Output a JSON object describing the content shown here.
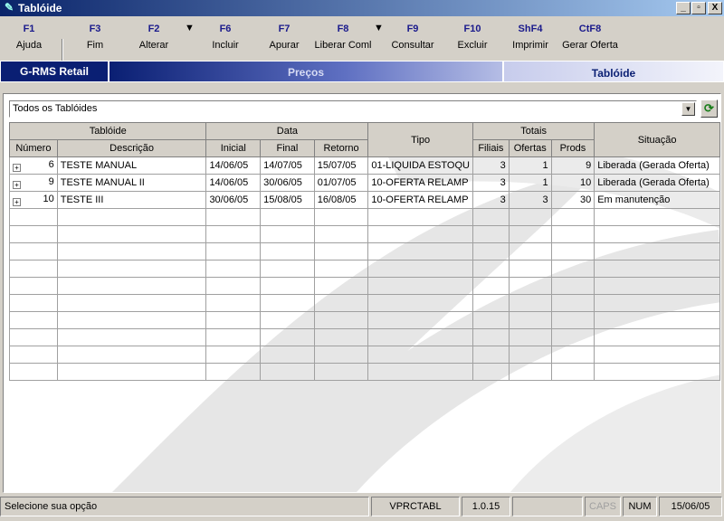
{
  "window": {
    "title": "Tablóide",
    "buttons": [
      "_",
      "▫",
      "X"
    ]
  },
  "toolbar": [
    {
      "key": "F1",
      "label": "Ajuda"
    },
    {
      "key": "F3",
      "label": "Fim"
    },
    {
      "key": "F2",
      "label": "Alterar"
    },
    {
      "key": "F6",
      "label": "Incluir"
    },
    {
      "key": "F7",
      "label": "Apurar"
    },
    {
      "key": "F8",
      "label": "Liberar Coml"
    },
    {
      "key": "F9",
      "label": "Consultar"
    },
    {
      "key": "F10",
      "label": "Excluir"
    },
    {
      "key": "ShF4",
      "label": "Imprimir"
    },
    {
      "key": "CtF8",
      "label": "Gerar Oferta"
    }
  ],
  "banner": {
    "app": "G-RMS Retail",
    "module": "Preços",
    "screen": "Tablóide"
  },
  "filter": {
    "selected": "Todos os Tablóides"
  },
  "table": {
    "group_headers": {
      "tabloide": "Tablóide",
      "data": "Data",
      "tipo": "Tipo",
      "totais": "Totais",
      "situacao": "Situação"
    },
    "columns": {
      "numero": "Número",
      "descricao": "Descrição",
      "inicial": "Inicial",
      "final": "Final",
      "retorno": "Retorno",
      "filiais": "Filiais",
      "ofertas": "Ofertas",
      "prods": "Prods"
    },
    "rows": [
      {
        "numero": "6",
        "descricao": "TESTE MANUAL",
        "inicial": "14/06/05",
        "final": "14/07/05",
        "retorno": "15/07/05",
        "tipo": "01-LIQUIDA ESTOQU",
        "filiais": "3",
        "ofertas": "1",
        "prods": "9",
        "situacao": "Liberada (Gerada Oferta)"
      },
      {
        "numero": "9",
        "descricao": "TESTE MANUAL II",
        "inicial": "14/06/05",
        "final": "30/06/05",
        "retorno": "01/07/05",
        "tipo": "10-OFERTA RELAMP",
        "filiais": "3",
        "ofertas": "1",
        "prods": "10",
        "situacao": "Liberada (Gerada Oferta)"
      },
      {
        "numero": "10",
        "descricao": "TESTE III",
        "inicial": "30/06/05",
        "final": "15/08/05",
        "retorno": "16/08/05",
        "tipo": "10-OFERTA RELAMP",
        "filiais": "3",
        "ofertas": "3",
        "prods": "30",
        "situacao": "Em manutenção"
      }
    ]
  },
  "status": {
    "message": "Selecione sua opção",
    "program": "VPRCTABL",
    "version": "1.0.15",
    "extra": "",
    "caps": "CAPS",
    "num": "NUM",
    "date": "15/06/05"
  }
}
